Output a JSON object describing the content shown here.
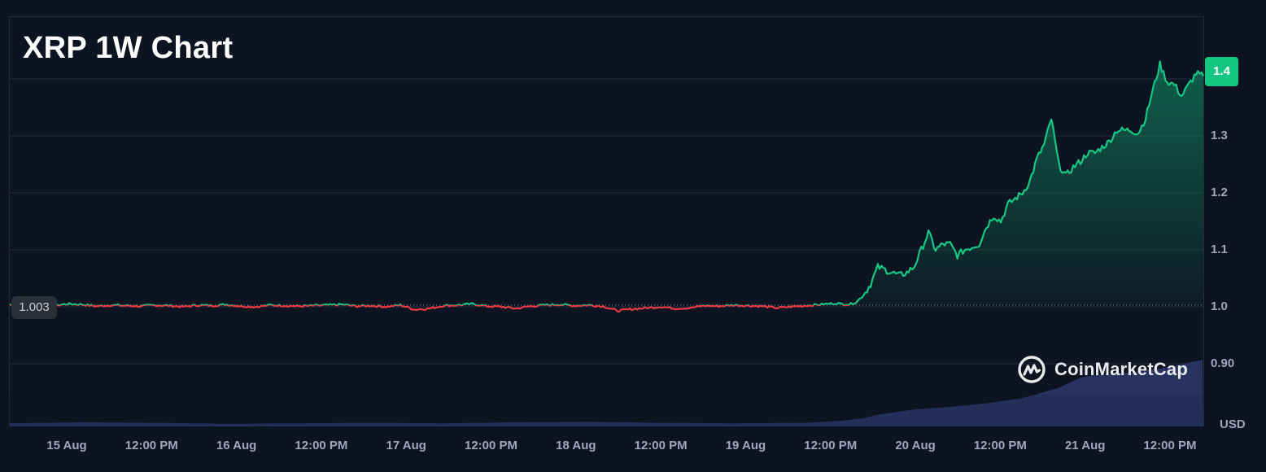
{
  "brand": {
    "name": "CoinMarketCap"
  },
  "chart_data": {
    "type": "line",
    "title": "XRP 1W Chart",
    "unit": "USD",
    "x_ticks": [
      "15 Aug",
      "12:00 PM",
      "16 Aug",
      "12:00 PM",
      "17 Aug",
      "12:00 PM",
      "18 Aug",
      "12:00 PM",
      "19 Aug",
      "12:00 PM",
      "20 Aug",
      "12:00 PM",
      "21 Aug",
      "12:00 PM"
    ],
    "y_ticks": [
      "0.90",
      "1.0",
      "1.1",
      "1.2",
      "1.3",
      "1.4"
    ],
    "ylim": [
      0.79,
      1.51
    ],
    "xlim": [
      0,
      165
    ],
    "reference_line": {
      "value": 1.003,
      "label": "1.003"
    },
    "current_price": {
      "value": 1.4,
      "label": "1.4"
    },
    "grid": true,
    "colors": {
      "up": "#16c784",
      "down": "#ea3943",
      "volume": "#2a3566",
      "background": "#0d1421"
    },
    "series": [
      {
        "x": [
          0,
          2,
          4,
          6,
          8,
          10,
          12,
          14,
          16,
          18,
          20,
          22,
          24,
          26,
          28,
          30,
          32,
          34,
          36,
          38,
          40,
          42,
          44,
          46,
          48,
          50,
          52,
          54,
          56,
          58,
          60,
          62,
          64,
          66,
          68,
          70,
          72,
          74,
          76,
          78,
          80,
          82,
          84,
          86,
          88,
          90,
          92,
          94,
          96,
          98,
          100,
          102,
          104,
          106,
          108,
          110,
          112,
          114,
          115,
          116,
          117,
          118,
          119,
          120,
          121,
          122,
          123,
          124,
          125,
          126,
          127,
          128,
          129,
          130,
          131,
          132,
          133,
          134,
          135,
          136,
          137,
          138,
          139,
          140,
          141,
          142,
          143,
          144,
          145,
          146,
          147,
          148,
          149,
          150,
          151,
          152,
          153,
          154,
          155,
          156,
          157,
          158,
          159,
          160,
          161,
          162,
          163,
          164,
          165
        ],
        "values": [
          1.004,
          0.995,
          1.0,
          1.002,
          1.005,
          1.004,
          1.001,
          1.003,
          1.002,
          1.001,
          1.003,
          1.002,
          1.0,
          1.003,
          1.002,
          1.004,
          1.001,
          1.0,
          1.003,
          1.002,
          1.001,
          1.002,
          1.003,
          1.004,
          1.001,
          1.002,
          1.0,
          1.003,
          0.995,
          0.997,
          1.002,
          1.003,
          1.005,
          1.001,
          1.0,
          0.997,
          1.001,
          1.003,
          1.004,
          1.002,
          1.003,
          1.001,
          0.993,
          0.996,
          0.998,
          1.0,
          0.997,
          0.998,
          1.002,
          1.001,
          1.003,
          1.002,
          1.001,
          0.998,
          1.0,
          1.002,
          1.004,
          1.006,
          1.005,
          1.004,
          1.008,
          1.02,
          1.04,
          1.07,
          1.065,
          1.06,
          1.055,
          1.06,
          1.07,
          1.1,
          1.13,
          1.1,
          1.11,
          1.11,
          1.09,
          1.1,
          1.105,
          1.11,
          1.14,
          1.16,
          1.15,
          1.18,
          1.19,
          1.2,
          1.22,
          1.26,
          1.285,
          1.33,
          1.25,
          1.23,
          1.245,
          1.255,
          1.27,
          1.27,
          1.28,
          1.29,
          1.31,
          1.31,
          1.31,
          1.305,
          1.33,
          1.38,
          1.425,
          1.395,
          1.39,
          1.37,
          1.39,
          1.41,
          1.405
        ]
      },
      {
        "name": "volume",
        "x": [
          0,
          10,
          20,
          30,
          40,
          50,
          60,
          70,
          80,
          90,
          100,
          110,
          115,
          118,
          120,
          125,
          130,
          135,
          140,
          145,
          148,
          150,
          155,
          160,
          165
        ],
        "values": [
          0.6,
          0.8,
          0.7,
          0.5,
          0.6,
          0.7,
          0.6,
          0.8,
          0.9,
          0.7,
          0.6,
          0.7,
          1.1,
          1.6,
          2.3,
          3.3,
          3.8,
          4.5,
          5.5,
          7.5,
          9.5,
          10.0,
          10.5,
          11.5,
          13.0
        ]
      }
    ]
  }
}
